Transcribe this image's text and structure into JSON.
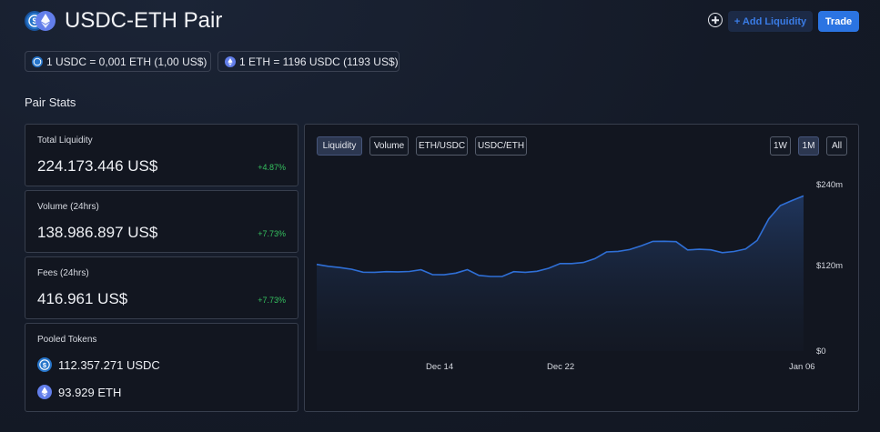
{
  "header": {
    "title": "USDC-ETH Pair",
    "add_liquidity_label": "+ Add Liquidity",
    "trade_label": "Trade"
  },
  "rates": [
    {
      "text": "1 USDC = 0,001 ETH (1,00 US$)",
      "icon": "usdc-icon"
    },
    {
      "text": "1 ETH = 1196 USDC (1193 US$)",
      "icon": "eth-icon"
    }
  ],
  "section_title": "Pair Stats",
  "stats": [
    {
      "label": "Total Liquidity",
      "value": "224.173.446 US$",
      "change": "+4.87%"
    },
    {
      "label": "Volume (24hrs)",
      "value": "138.986.897 US$",
      "change": "+7.73%"
    },
    {
      "label": "Fees (24hrs)",
      "value": "416.961 US$",
      "change": "+7.73%"
    }
  ],
  "pooled": {
    "label": "Pooled Tokens",
    "tokens": [
      {
        "amount": "112.357.271 USDC",
        "icon": "usdc-icon"
      },
      {
        "amount": "93.929 ETH",
        "icon": "eth-icon"
      }
    ]
  },
  "chart": {
    "tabs": [
      "Liquidity",
      "Volume",
      "ETH/USDC",
      "USDC/ETH"
    ],
    "active_tab": "Liquidity",
    "ranges": [
      "1W",
      "1M",
      "All"
    ],
    "active_range": "1M"
  },
  "colors": {
    "accent": "#2b74e2",
    "positive": "#35c25f",
    "usdc": "#2775ca",
    "eth": "#627eea",
    "line": "#2f6fd6"
  },
  "chart_data": {
    "type": "area",
    "series": [
      {
        "values": [
          125.0,
          122.2,
          120.4,
          118.0,
          113.7,
          113.6,
          114.5,
          114.2,
          114.7,
          117.2,
          110.2,
          110.0,
          112.4,
          117.4,
          109.1,
          107.6,
          107.5,
          114.5,
          113.6,
          115.0,
          119.4,
          126.2,
          126.2,
          127.8,
          133.2,
          143.0,
          143.8,
          146.4,
          151.9,
          158.1,
          158.3,
          157.8,
          145.9,
          146.7,
          146.0,
          141.9,
          143.6,
          147.1,
          159.5,
          190.7,
          209.9,
          217.1,
          223.8
        ]
      }
    ],
    "x_tick_labels": [
      "Dec 14",
      "Dec 22",
      "Jan 06"
    ],
    "y_tick_labels": [
      "$240m",
      "$120m",
      "$0"
    ],
    "ylim": [
      0,
      240
    ],
    "grid": false
  }
}
